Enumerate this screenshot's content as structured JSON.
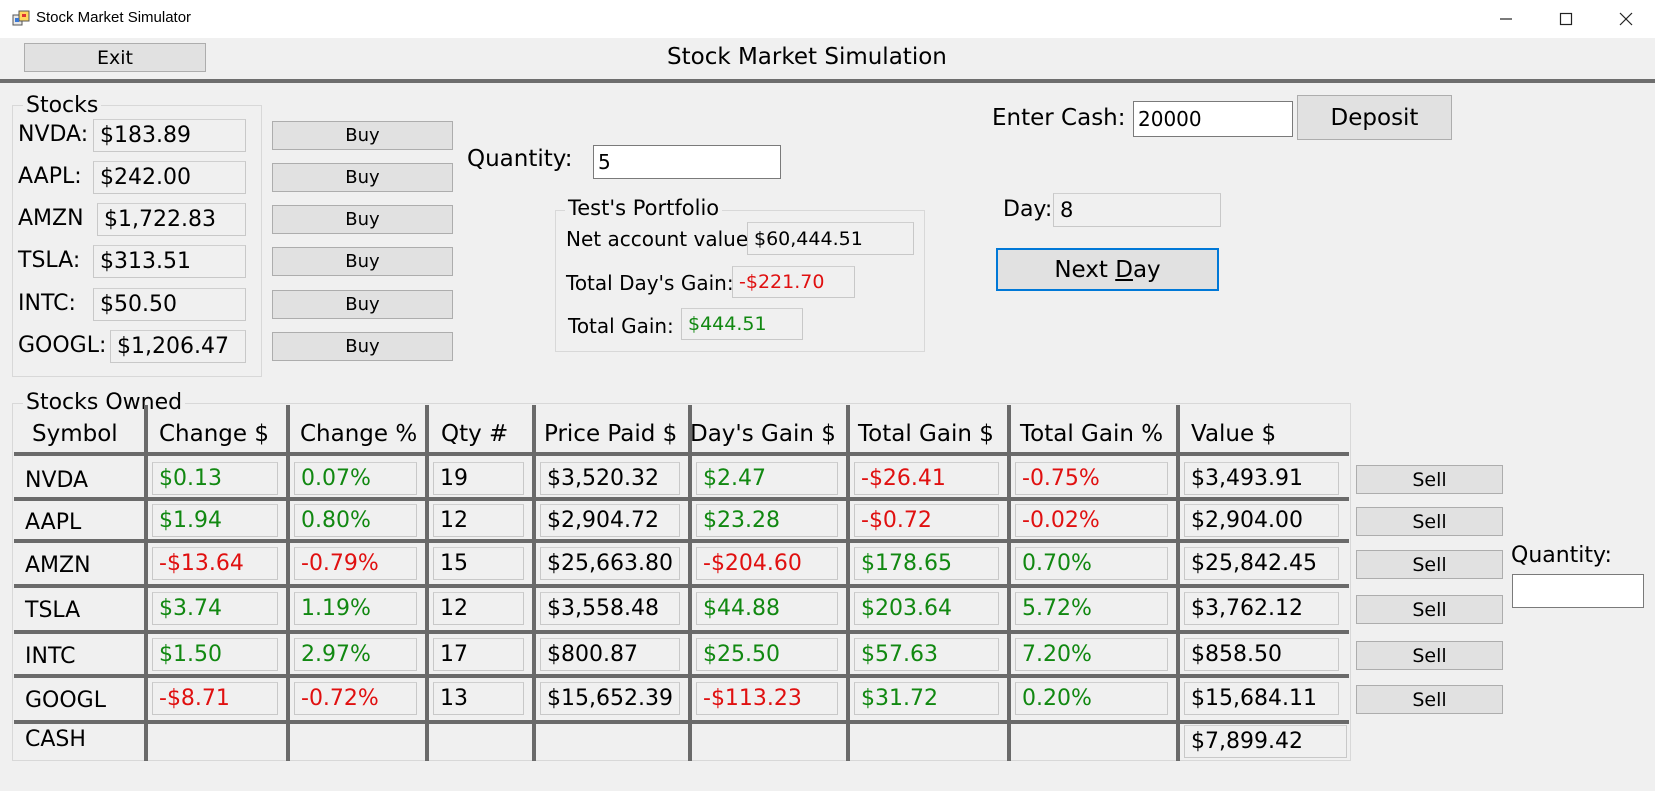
{
  "window": {
    "title": "Stock Market Simulator"
  },
  "header": {
    "exit_label": "Exit",
    "title": "Stock Market Simulation"
  },
  "stocks_group": {
    "title": "Stocks",
    "buy_label": "Buy",
    "items": [
      {
        "label": "NVDA:",
        "price": "$183.89"
      },
      {
        "label": "AAPL:",
        "price": "$242.00"
      },
      {
        "label": "AMZN",
        "price": "$1,722.83"
      },
      {
        "label": "TSLA:",
        "price": "$313.51"
      },
      {
        "label": "INTC:",
        "price": "$50.50"
      },
      {
        "label": "GOOGL:",
        "price": "$1,206.47"
      }
    ]
  },
  "buy_quantity": {
    "label": "Quantity:",
    "value": "5"
  },
  "portfolio": {
    "title": "Test's Portfolio",
    "net_label": "Net account value:",
    "net_value": "$60,444.51",
    "day_gain_label": "Total Day's Gain:",
    "day_gain_value": "-$221.70",
    "total_gain_label": "Total Gain:",
    "total_gain_value": "$444.51"
  },
  "cash": {
    "label": "Enter Cash:",
    "value": "20000",
    "deposit_label": "Deposit"
  },
  "day": {
    "label": "Day:",
    "value": "8",
    "next_label_pre": "Next ",
    "next_label_ul": "D",
    "next_label_post": "ay"
  },
  "owned": {
    "title": "Stocks Owned",
    "headers": [
      "Symbol",
      "Change $",
      "Change %",
      "Qty #",
      "Price Paid $",
      "Day's Gain $",
      "Total Gain $",
      "Total Gain %",
      "Value $"
    ],
    "sell_label": "Sell",
    "rows": [
      {
        "symbol": "NVDA",
        "change": "$0.13",
        "change_pct": "0.07%",
        "qty": "19",
        "paid": "$3,520.32",
        "day_gain": "$2.47",
        "total_gain": "-$26.41",
        "total_gain_pct": "-0.75%",
        "value": "$3,493.91"
      },
      {
        "symbol": "AAPL",
        "change": "$1.94",
        "change_pct": "0.80%",
        "qty": "12",
        "paid": "$2,904.72",
        "day_gain": "$23.28",
        "total_gain": "-$0.72",
        "total_gain_pct": "-0.02%",
        "value": "$2,904.00"
      },
      {
        "symbol": "AMZN",
        "change": "-$13.64",
        "change_pct": "-0.79%",
        "qty": "15",
        "paid": "$25,663.80",
        "day_gain": "-$204.60",
        "total_gain": "$178.65",
        "total_gain_pct": "0.70%",
        "value": "$25,842.45"
      },
      {
        "symbol": "TSLA",
        "change": "$3.74",
        "change_pct": "1.19%",
        "qty": "12",
        "paid": "$3,558.48",
        "day_gain": "$44.88",
        "total_gain": "$203.64",
        "total_gain_pct": "5.72%",
        "value": "$3,762.12"
      },
      {
        "symbol": "INTC",
        "change": "$1.50",
        "change_pct": "2.97%",
        "qty": "17",
        "paid": "$800.87",
        "day_gain": "$25.50",
        "total_gain": "$57.63",
        "total_gain_pct": "7.20%",
        "value": "$858.50"
      },
      {
        "symbol": "GOOGL",
        "change": "-$8.71",
        "change_pct": "-0.72%",
        "qty": "13",
        "paid": "$15,652.39",
        "day_gain": "-$113.23",
        "total_gain": "$31.72",
        "total_gain_pct": "0.20%",
        "value": "$15,684.11"
      }
    ],
    "cash_row": {
      "symbol": "CASH",
      "value": "$7,899.42"
    }
  },
  "sell_quantity": {
    "label": "Quantity:",
    "value": ""
  },
  "colors": {
    "gain": "#118811",
    "loss": "#e01010",
    "focus": "#0078d7"
  }
}
